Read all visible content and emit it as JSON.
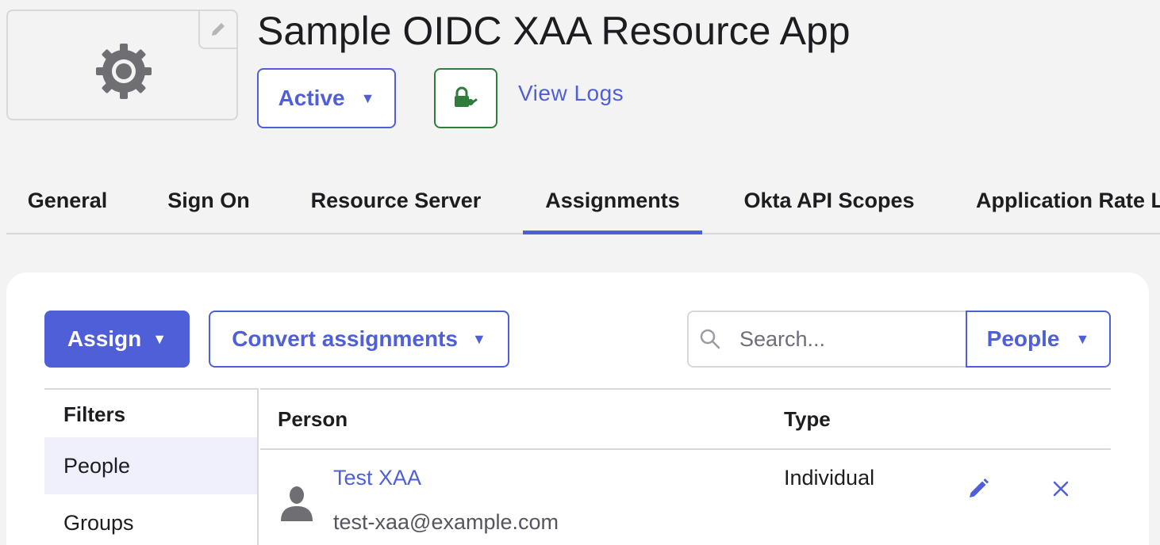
{
  "app": {
    "title": "Sample OIDC XAA Resource App",
    "status_label": "Active",
    "view_logs_label": "View Logs"
  },
  "tabs": [
    {
      "label": "General",
      "active": false
    },
    {
      "label": "Sign On",
      "active": false
    },
    {
      "label": "Resource Server",
      "active": false
    },
    {
      "label": "Assignments",
      "active": true
    },
    {
      "label": "Okta API Scopes",
      "active": false
    },
    {
      "label": "Application Rate L",
      "active": false
    }
  ],
  "toolbar": {
    "assign_label": "Assign",
    "convert_label": "Convert assignments",
    "search_placeholder": "Search...",
    "people_select_label": "People"
  },
  "filters": {
    "title": "Filters",
    "items": [
      {
        "label": "People",
        "selected": true
      },
      {
        "label": "Groups",
        "selected": false
      }
    ]
  },
  "table": {
    "headers": {
      "person": "Person",
      "type": "Type"
    },
    "rows": [
      {
        "name": "Test XAA",
        "email": "test-xaa@example.com",
        "type": "Individual"
      }
    ]
  },
  "icons": {
    "logo": "gear-icon",
    "edit_logo": "pencil-icon",
    "key": "lock-key-icon",
    "search": "search-icon",
    "row_edit": "pencil-icon",
    "row_remove": "close-icon"
  },
  "colors": {
    "accent": "#4f5fd8",
    "success": "#2e7d3a",
    "background": "#f3f3f3"
  }
}
